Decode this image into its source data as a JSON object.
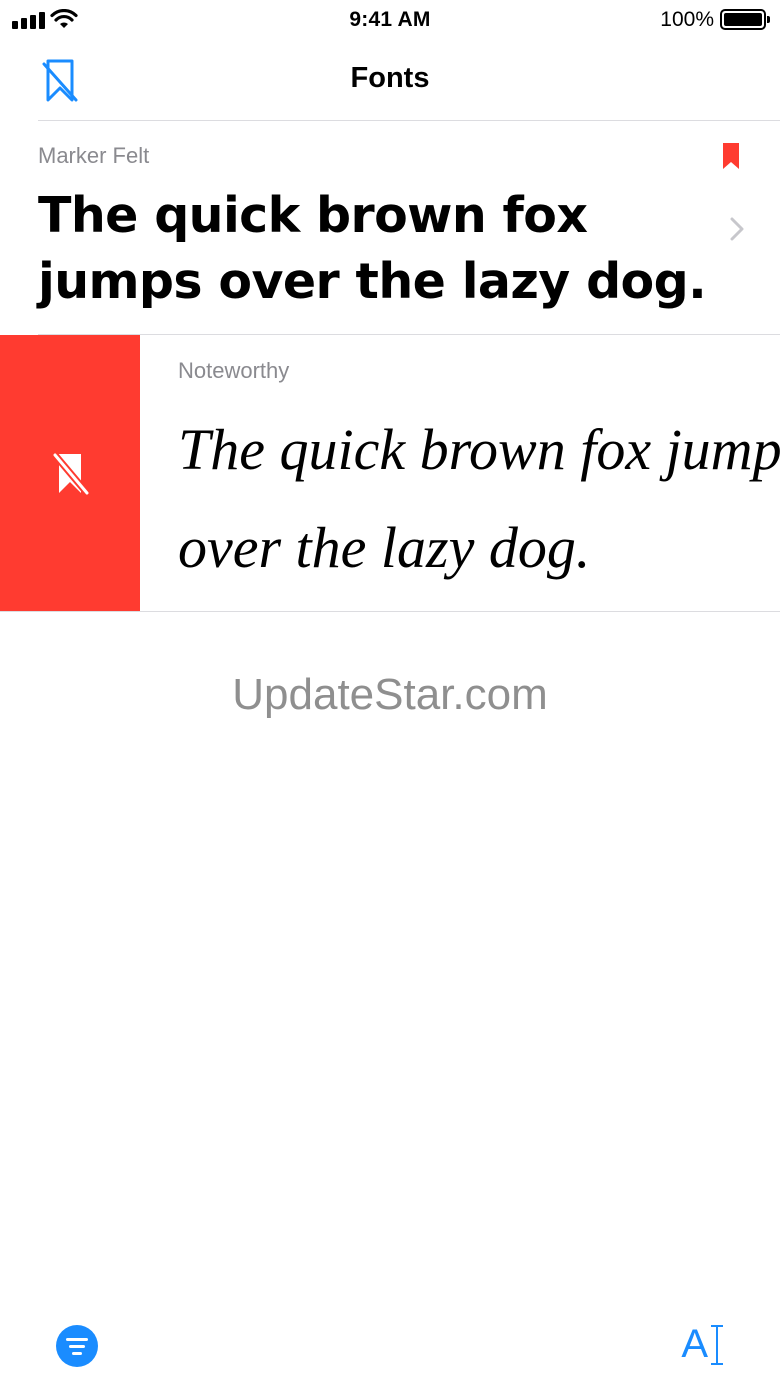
{
  "status_bar": {
    "time": "9:41 AM",
    "battery_percent": "100%",
    "battery_level": 1.0
  },
  "nav": {
    "title": "Fonts",
    "left_icon": "bookmark-slash-icon"
  },
  "fonts": [
    {
      "name": "Marker Felt",
      "sample": "The quick brown fox jumps over the lazy dog.",
      "bookmarked": true
    },
    {
      "name": "Noteworthy",
      "sample_line_1": "The quick brown fox jumps",
      "sample_line_2": "over the lazy dog.",
      "swipe_action_icon": "bookmark-slash-icon"
    }
  ],
  "watermark": "UpdateStar.com",
  "toolbar": {
    "left_icon": "filter-icon",
    "right_label": "A",
    "right_icon": "text-cursor-icon"
  },
  "colors": {
    "accent": "#1a8cff",
    "destructive": "#ff3b30",
    "secondary_text": "#8a8a8f"
  }
}
